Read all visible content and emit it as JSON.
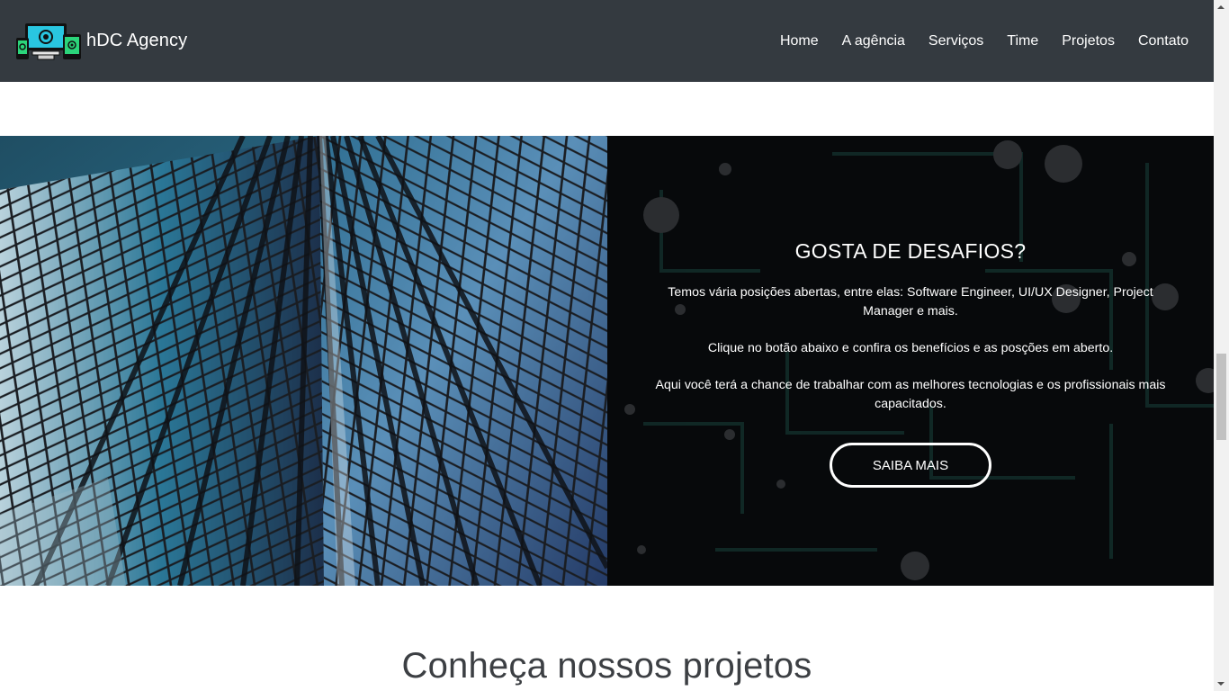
{
  "brand": {
    "name": "hDC Agency",
    "logo_icon": "devices-logo-icon"
  },
  "nav": {
    "items": [
      {
        "label": "Home"
      },
      {
        "label": "A agência"
      },
      {
        "label": "Serviços"
      },
      {
        "label": "Time"
      },
      {
        "label": "Projetos"
      },
      {
        "label": "Contato"
      }
    ]
  },
  "feature": {
    "image_icon": "skyscraper-glass-building-photo",
    "title": "GOSTA DE DESAFIOS?",
    "paragraphs": [
      "Temos vária posições abertas, entre elas: Software Engineer, UI/UX Designer, Project Manager e mais.",
      "Clique no botão abaixo e confira os benefícios e as posções em aberto.",
      "Aqui você terá a chance de trabalhar com as melhores tecnologias e os profissionais mais capacitados."
    ],
    "button_label": "SAIBA MAIS"
  },
  "projects": {
    "heading": "Conheça nossos projetos"
  },
  "colors": {
    "navbar": "#343a40",
    "panel": "#07090b",
    "heading": "#3c3f43"
  }
}
